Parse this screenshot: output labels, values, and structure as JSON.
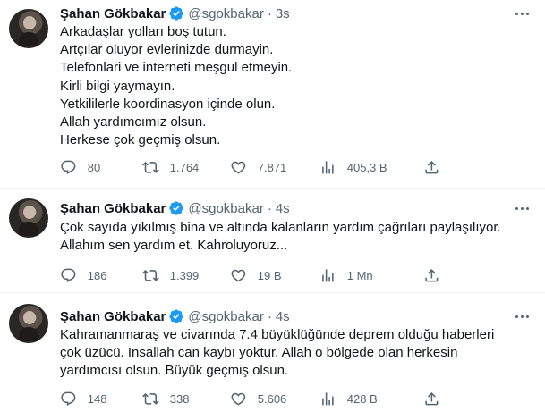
{
  "tweets": [
    {
      "name": "Şahan Gökbakar",
      "handle": "@sgokbakar",
      "dot": "·",
      "time": "3s",
      "lines": [
        "Arkadaşlar yolları boş tutun.",
        "Artçılar oluyor evlerinizde durmayin.",
        "Telefonlari ve interneti meşgul etmeyin.",
        "Kirli bilgi yaymayın.",
        "Yetkililerle koordinasyon içinde olun.",
        "Allah yardımcımız olsun.",
        "Herkese çok geçmiş olsun."
      ],
      "replies": "80",
      "retweets": "1.764",
      "likes": "7.871",
      "views": "405,3 B"
    },
    {
      "name": "Şahan Gökbakar",
      "handle": "@sgokbakar",
      "dot": "·",
      "time": "4s",
      "lines": [
        "Çok sayıda yıkılmış bina ve altında kalanların yardım çağrıları paylaşılıyor.",
        "Allahım sen yardım et. Kahroluyoruz..."
      ],
      "replies": "186",
      "retweets": "1.399",
      "likes": "19 B",
      "views": "1 Mn"
    },
    {
      "name": "Şahan Gökbakar",
      "handle": "@sgokbakar",
      "dot": "·",
      "time": "4s",
      "lines": [
        "Kahramanmaraş ve civarında 7.4 büyüklüğünde deprem olduğu haberleri",
        "çok üzücü. Insallah can kaybı yoktur. Allah o bölgede olan herkesin",
        "yardımcısı olsun. Büyük geçmiş olsun."
      ],
      "replies": "148",
      "retweets": "338",
      "likes": "5.606",
      "views": "428 B"
    }
  ],
  "icons": {
    "verified": "verified-badge-icon",
    "reply": "reply-icon",
    "retweet": "retweet-icon",
    "like": "heart-icon",
    "views": "views-chart-icon",
    "share": "share-icon",
    "more": "more-options-icon"
  },
  "colors": {
    "verified": "#1d9bf0",
    "text": "#0f1419",
    "secondary": "#536471",
    "divider": "#eff3f4"
  }
}
